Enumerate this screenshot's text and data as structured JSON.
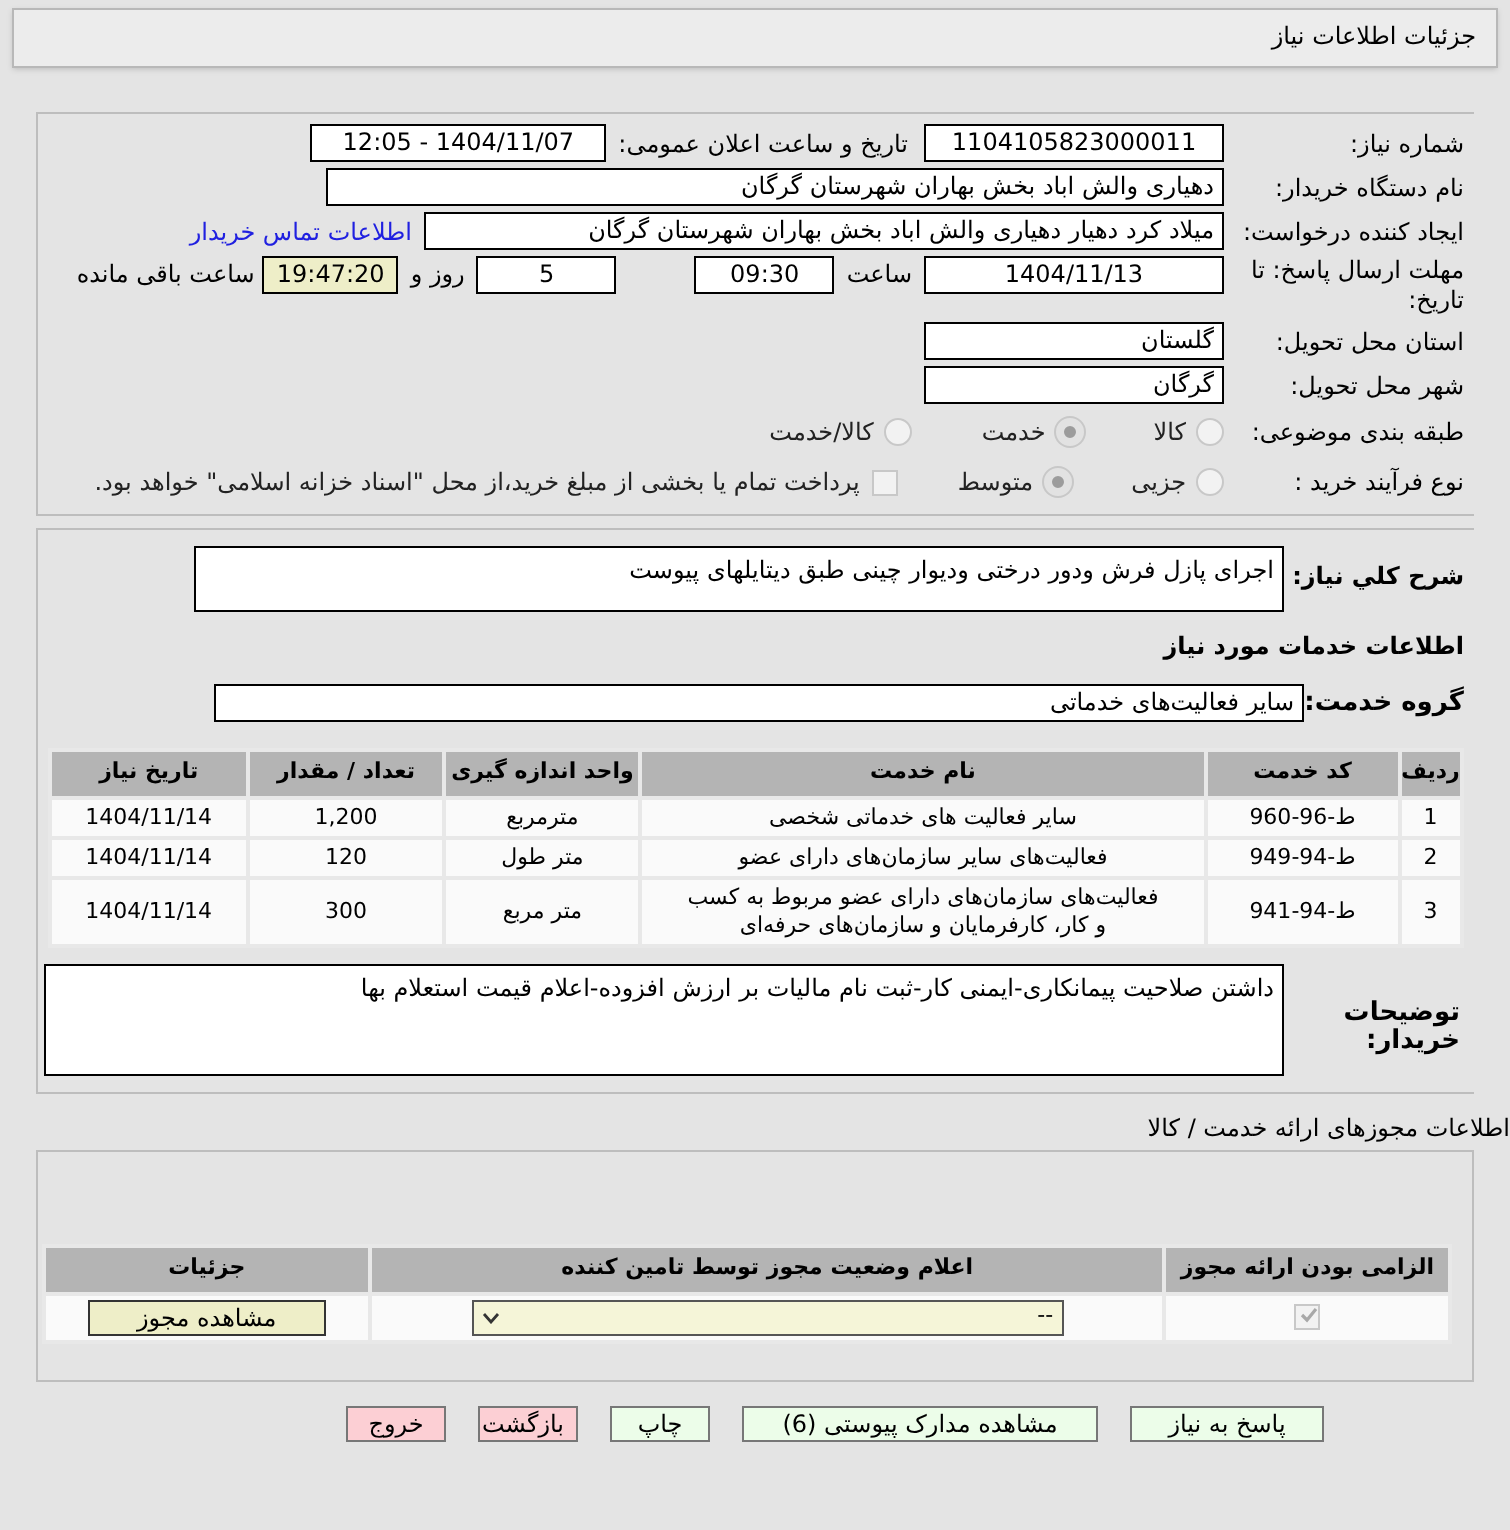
{
  "title": "جزئیات اطلاعات نیاز",
  "need_number": {
    "label": "شماره نیاز:",
    "value": "1104105823000011"
  },
  "announce": {
    "label": "تاریخ و ساعت اعلان عمومی:",
    "value": "1404/11/07 - 12:05"
  },
  "buyer_org": {
    "label": "نام دستگاه خریدار:",
    "value": "دهیاری والش اباد بخش بهاران شهرستان گرگان"
  },
  "requester": {
    "label": "ایجاد کننده درخواست:",
    "value": "میلاد کرد دهیار دهیاری والش اباد بخش بهاران شهرستان گرگان",
    "link": "اطلاعات تماس خریدار"
  },
  "deadline": {
    "label": "مهلت ارسال پاسخ: تا تاریخ:",
    "date": "1404/11/13",
    "time_label": "ساعت",
    "time": "09:30",
    "days": "5",
    "days_label": "روز و",
    "remaining": "19:47:20",
    "remaining_label": "ساعت باقی مانده"
  },
  "province": {
    "label": "استان محل تحویل:",
    "value": "گلستان"
  },
  "city": {
    "label": "شهر محل تحویل:",
    "value": "گرگان"
  },
  "category": {
    "label": "طبقه بندی موضوعی:",
    "options": [
      {
        "label": "کالا",
        "selected": false
      },
      {
        "label": "خدمت",
        "selected": true
      },
      {
        "label": "کالا/خدمت",
        "selected": false
      }
    ]
  },
  "process": {
    "label": "نوع فرآیند خرید :",
    "options": [
      {
        "label": "جزیی",
        "selected": false
      },
      {
        "label": "متوسط",
        "selected": true
      }
    ],
    "payment": {
      "label": "پرداخت تمام یا بخشی از مبلغ خرید،از محل \"اسناد خزانه اسلامی\" خواهد بود.",
      "checked": false
    }
  },
  "summary": {
    "label": "شرح کلي نياز:",
    "value": "اجرای پازل فرش ودور درختی ودیوار چینی طبق دیتایلهای پیوست"
  },
  "services_heading": "اطلاعات خدمات مورد نیاز",
  "service_group": {
    "label": "گروه خدمت:",
    "value": "سایر فعالیت‌های خدماتی"
  },
  "table": {
    "columns": [
      "ردیف",
      "کد خدمت",
      "نام خدمت",
      "واحد اندازه گیری",
      "تعداد / مقدار",
      "تاریخ نیاز"
    ],
    "rows": [
      [
        "1",
        "ط-96-960",
        "سایر فعالیت های خدماتی شخصی",
        "مترمربع",
        "1,200",
        "1404/11/14"
      ],
      [
        "2",
        "ط-94-949",
        "فعالیت‌های سایر سازمان‌های دارای عضو",
        "متر طول",
        "120",
        "1404/11/14"
      ],
      [
        "3",
        "ط-94-941",
        "فعالیت‌های سازمان‌های دارای عضو مربوط به کسب و کار، کارفرمایان و سازمان‌های حرفه‌ای",
        "متر مربع",
        "300",
        "1404/11/14"
      ]
    ]
  },
  "notes": {
    "label": "توضیحات خریدار:",
    "value": "داشتن صلاحیت پیمانکاری-ایمنی کار-ثبت نام مالیات بر ارزش افزوده-اعلام قیمت استعلام بها"
  },
  "licenses": {
    "heading": "اطلاعات مجوزهای ارائه خدمت / کالا",
    "columns": [
      "الزامی بودن ارائه مجوز",
      "اعلام وضعیت مجوز توسط تامین کننده",
      "جزئیات"
    ],
    "rows": [
      {
        "required": true,
        "status": "--",
        "button": "مشاهده مجوز"
      }
    ]
  },
  "buttons": [
    {
      "label": "پاسخ به نیاز",
      "kind": "green"
    },
    {
      "label": "مشاهده مدارک پیوستی (6)",
      "kind": "green"
    },
    {
      "label": "چاپ",
      "kind": "green"
    },
    {
      "label": "بازگشت",
      "kind": "pink"
    },
    {
      "label": "خروج",
      "kind": "pink"
    }
  ]
}
